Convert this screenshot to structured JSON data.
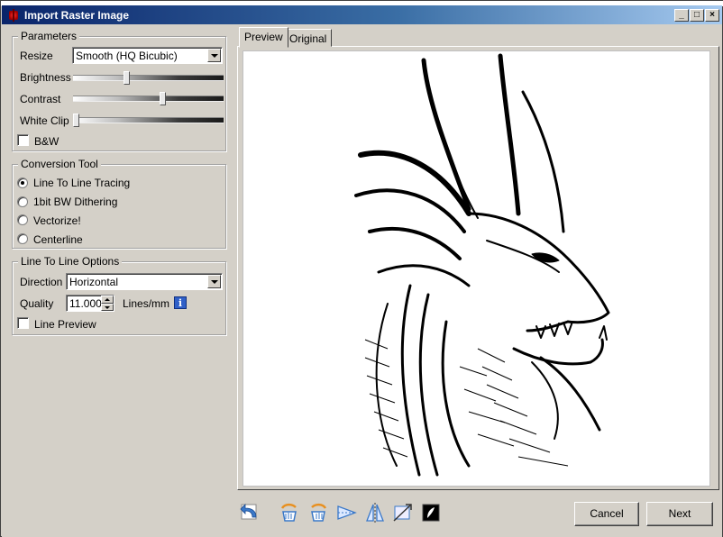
{
  "window": {
    "title": "Import Raster Image"
  },
  "title_buttons": {
    "minimize": "_",
    "maximize": "□",
    "close": "×"
  },
  "parameters": {
    "legend": "Parameters",
    "resize_label": "Resize",
    "resize_value": "Smooth (HQ Bicubic)",
    "brightness_label": "Brightness",
    "brightness_level": 0.35,
    "contrast_label": "Contrast",
    "contrast_level": 0.6,
    "whiteclip_label": "White Clip",
    "whiteclip_level": 0.0,
    "bw_label": "B&W",
    "bw_checked": false
  },
  "conversion": {
    "legend": "Conversion Tool",
    "options": [
      {
        "label": "Line To Line Tracing",
        "checked": true
      },
      {
        "label": "1bit BW Dithering",
        "checked": false
      },
      {
        "label": "Vectorize!",
        "checked": false
      },
      {
        "label": "Centerline",
        "checked": false
      }
    ]
  },
  "line_options": {
    "legend": "Line To Line Options",
    "direction_label": "Direction",
    "direction_value": "Horizontal",
    "quality_label": "Quality",
    "quality_value": "11.000",
    "quality_unit": "Lines/mm",
    "info_icon": "i",
    "line_preview_label": "Line Preview",
    "line_preview_checked": false
  },
  "tabs": [
    {
      "label": "Preview",
      "active": true
    },
    {
      "label": "Original",
      "active": false
    }
  ],
  "toolbar_icons": [
    "undo-arrow-icon",
    "rotate-left-hand-icon",
    "rotate-right-hand-icon",
    "flip-horizontal-icon",
    "flip-vertical-icon",
    "crop-icon",
    "invert-icon"
  ],
  "buttons": {
    "cancel": "Cancel",
    "next": "Next"
  },
  "colors": {
    "title_start": "#0a246a",
    "title_end": "#a6caf0",
    "face": "#d4d0c8"
  }
}
